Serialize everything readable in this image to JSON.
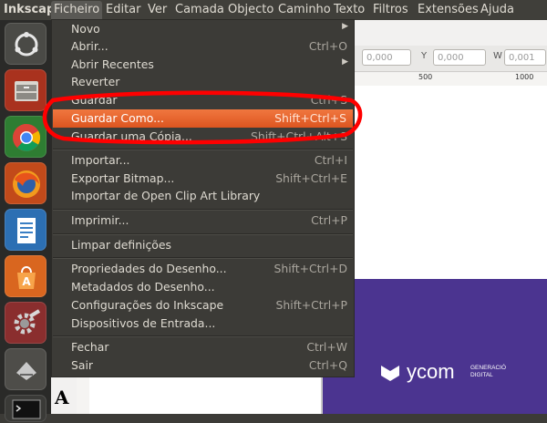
{
  "menubar": {
    "app_name": "Inkscape",
    "items": [
      "Ficheiro",
      "Editar",
      "Ver",
      "Camada",
      "Objecto",
      "Caminho",
      "Texto",
      "Filtros",
      "Extensões",
      "Ajuda"
    ]
  },
  "toolbar": {
    "x_value": "0,000",
    "y_label": "Y",
    "y_value": "0,000",
    "w_label": "W",
    "w_value": "0,001"
  },
  "ruler": {
    "tick_a": "500",
    "tick_b": "1000"
  },
  "menu": {
    "items": [
      {
        "label": "Novo",
        "submenu": true
      },
      {
        "label": "Abrir...",
        "accel": "Ctrl+O"
      },
      {
        "label": "Abrir Recentes",
        "submenu": true
      },
      {
        "label": "Reverter"
      },
      {
        "label": "Guardar",
        "accel": "Ctrl+S"
      },
      {
        "label": "Guardar Como...",
        "accel": "Shift+Ctrl+S",
        "highlighted": true
      },
      {
        "label": "Guardar uma Cópia...",
        "accel": "Shift+Ctrl+Alt+S"
      },
      {
        "label": "Importar...",
        "accel": "Ctrl+I"
      },
      {
        "label": "Exportar Bitmap...",
        "accel": "Shift+Ctrl+E"
      },
      {
        "label": "Importar de Open Clip Art Library"
      },
      {
        "label": "Imprimir...",
        "accel": "Ctrl+P"
      },
      {
        "label": "Limpar definições"
      },
      {
        "label": "Propriedades do Desenho...",
        "accel": "Shift+Ctrl+D"
      },
      {
        "label": "Metadados do Desenho..."
      },
      {
        "label": "Configurações do Inkscape",
        "accel": "Shift+Ctrl+P"
      },
      {
        "label": "Dispositivos de Entrada..."
      },
      {
        "label": "Fechar",
        "accel": "Ctrl+W"
      },
      {
        "label": "Sair",
        "accel": "Ctrl+Q"
      }
    ]
  },
  "promo": {
    "brand": "ycom",
    "tagline_1": "GENERACIÓ",
    "tagline_2": "DIGITAL"
  },
  "canvas_text": {
    "glyph": "A"
  },
  "colors": {
    "highlight": "#f07746",
    "annotation": "#ff0000",
    "promo_bg": "#4b3490"
  },
  "launcher_icons": [
    "ubuntu-dash-icon",
    "files-icon",
    "chrome-icon",
    "firefox-icon",
    "writer-icon",
    "software-center-icon",
    "settings-icon",
    "disks-icon",
    "terminal-icon"
  ]
}
